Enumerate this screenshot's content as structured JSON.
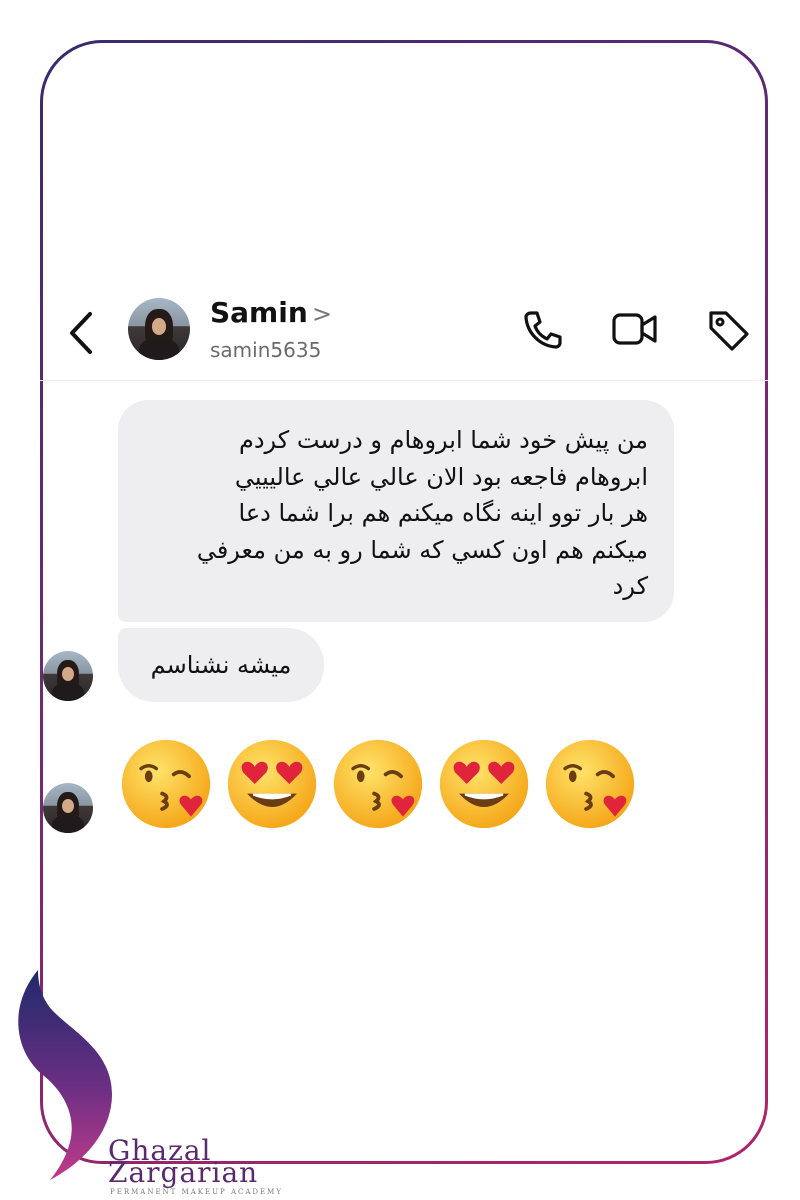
{
  "header": {
    "name": "Samin",
    "name_chevron": ">",
    "username": "samin5635"
  },
  "icons": {
    "back": "chevron-left-icon",
    "call": "phone-icon",
    "video": "video-camera-icon",
    "tag": "tag-icon"
  },
  "messages": [
    {
      "lines": [
        "من پيش خود شما ابروهام و  درست کردم",
        "ابروهام فاجعه بود الان عالي عالي عاليييي",
        "هر بار توو اينه نگاه ميکنم هم برا شما دعا",
        "ميکنم هم اون کسي که شما رو به من معرفي",
        "کرد"
      ]
    },
    {
      "text": "ميشه نشناسم"
    }
  ],
  "emojis": [
    "face-blowing-kiss",
    "smiling-face-with-heart-eyes",
    "face-blowing-kiss",
    "smiling-face-with-heart-eyes",
    "face-blowing-kiss"
  ],
  "brand": {
    "line1": "Ghazal",
    "line2": "Zargarian",
    "line3": "PERMANENT MAKEUP ACADEMY"
  },
  "colors": {
    "frame_start": "#3a2a6e",
    "frame_end": "#b12468",
    "bubble": "#eeeef1"
  }
}
